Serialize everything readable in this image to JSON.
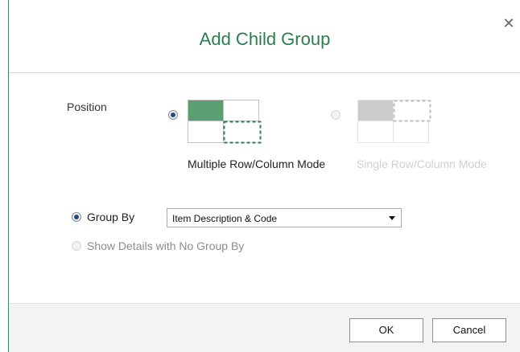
{
  "dialog": {
    "title": "Add Child Group",
    "close_glyph": "✕"
  },
  "position": {
    "label": "Position",
    "options": [
      {
        "label": "Multiple Row/Column Mode",
        "selected": true,
        "enabled": true
      },
      {
        "label": "Single Row/Column Mode",
        "selected": false,
        "enabled": false
      }
    ]
  },
  "group": {
    "group_by_label": "Group By",
    "group_by_selected": true,
    "select_value": "Item Description & Code",
    "no_group_label": "Show Details with No Group By",
    "no_group_enabled": false
  },
  "buttons": {
    "ok": "OK",
    "cancel": "Cancel"
  },
  "colors": {
    "accent": "#2e7d4f",
    "accent_fill": "#5b9e72",
    "disabled_fill": "#cccccc"
  },
  "icons": {
    "close": "close-icon",
    "dropdown": "chevron-down-icon"
  }
}
